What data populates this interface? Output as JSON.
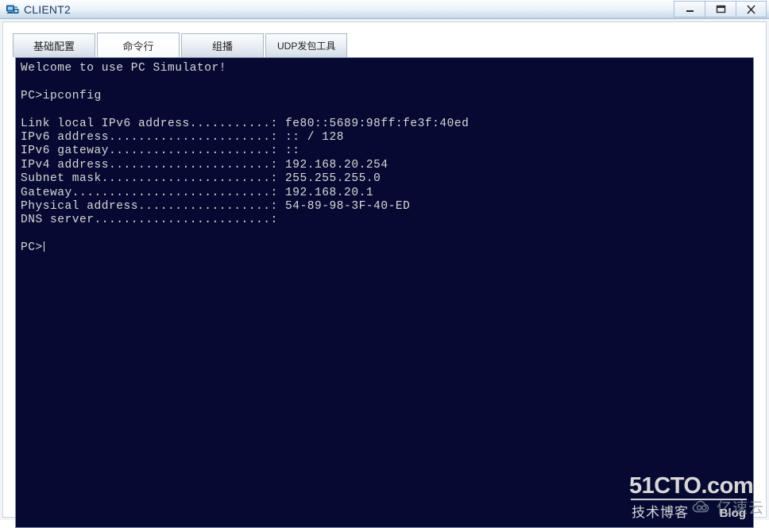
{
  "window": {
    "title": "CLIENT2",
    "icon": "pc-client-icon",
    "controls": {
      "minimize": "minimize-icon",
      "maximize": "maximize-icon",
      "close": "close-icon"
    }
  },
  "tabs": [
    {
      "label": "基础配置",
      "active": false
    },
    {
      "label": "命令行",
      "active": true
    },
    {
      "label": "组播",
      "active": false
    },
    {
      "label": "UDP发包工具",
      "active": false
    }
  ],
  "terminal": {
    "background_color": "#060a32",
    "text_color": "#d8d8d8",
    "lines": [
      "Welcome to use PC Simulator!",
      "",
      "PC>ipconfig",
      "",
      "Link local IPv6 address...........: fe80::5689:98ff:fe3f:40ed",
      "IPv6 address......................: :: / 128",
      "IPv6 gateway......................: ::",
      "IPv4 address......................: 192.168.20.254",
      "Subnet mask.......................: 255.255.255.0",
      "Gateway...........................: 192.168.20.1",
      "Physical address..................: 54-89-98-3F-40-ED",
      "DNS server........................:",
      ""
    ],
    "prompt": "PC>",
    "cursor_visible": true,
    "command": "ipconfig",
    "values": {
      "link_local_ipv6_address": "fe80::5689:98ff:fe3f:40ed",
      "ipv6_address": ":: / 128",
      "ipv6_gateway": "::",
      "ipv4_address": "192.168.20.254",
      "subnet_mask": "255.255.255.0",
      "gateway": "192.168.20.1",
      "physical_address": "54-89-98-3F-40-ED",
      "dns_server": ""
    }
  },
  "watermarks": {
    "cto": {
      "main": "51CTO.com",
      "sub_cn": "技术博客",
      "sub_en": "Blog"
    },
    "yisuyun": {
      "text": "亿速云",
      "icon": "cloud-icon"
    }
  }
}
